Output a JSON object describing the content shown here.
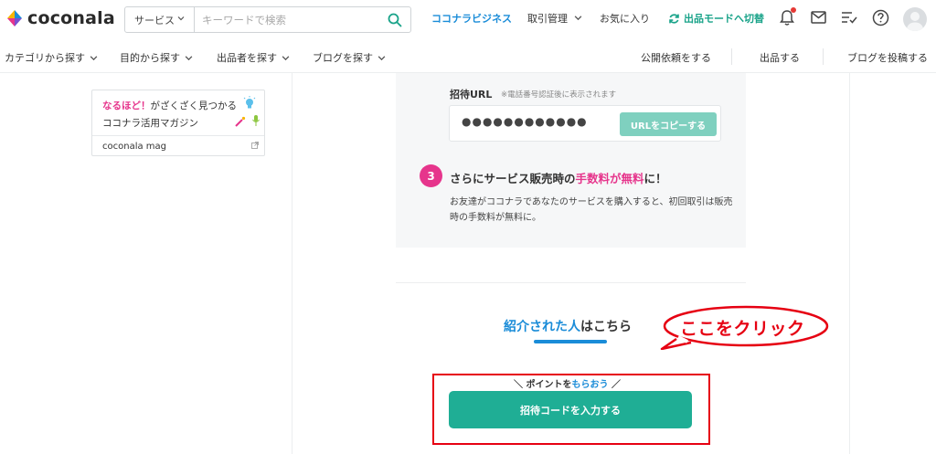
{
  "brand": {
    "name": "coconala"
  },
  "search": {
    "category": "サービス",
    "placeholder": "キーワードで検索",
    "value": ""
  },
  "header": {
    "business_link": "ココナラビジネス",
    "trade_menu": "取引管理",
    "favorites": "お気に入り",
    "sell_mode": "出品モードへ切替",
    "icons": [
      "bell-icon",
      "mail-icon",
      "checklist-icon",
      "help-icon",
      "avatar"
    ]
  },
  "subnav": {
    "left": [
      "カテゴリから探す",
      "目的から探す",
      "出品者を探す",
      "ブログを探す"
    ],
    "right": [
      "公開依頼をする",
      "出品する",
      "ブログを投稿する"
    ]
  },
  "mag_card": {
    "highlight": "なるほど！",
    "line1_rest": "がざくざく見つかる",
    "line2": "ココナラ活用マガジン",
    "footer": "coconala mag"
  },
  "invite": {
    "url_label": "招待URL",
    "url_note": "※電話番号認証後に表示されます",
    "url_masked": "●●●●●●●●●●●●",
    "copy_button": "URLをコピーする"
  },
  "step3": {
    "number": "3",
    "title_pre": "さらにサービス販売時の",
    "title_highlight": "手数料が無料",
    "title_post": "に！",
    "description": "お友達がココナラであなたのサービスを購入すると、初回取引は販売時の手数料が無料に。"
  },
  "referred": {
    "title_highlight": "紹介された人",
    "title_rest": "はこちら",
    "point_pre": "＼ ポイントを",
    "point_highlight": "もらおう",
    "point_post": " ／",
    "cta_button": "招待コードを入力する"
  },
  "annotation": {
    "text": "ここをクリック"
  },
  "colors": {
    "accent_blue": "#1a8cd8",
    "accent_green": "#1fae95",
    "accent_pink": "#e6358c",
    "annotation_red": "#e60012"
  }
}
